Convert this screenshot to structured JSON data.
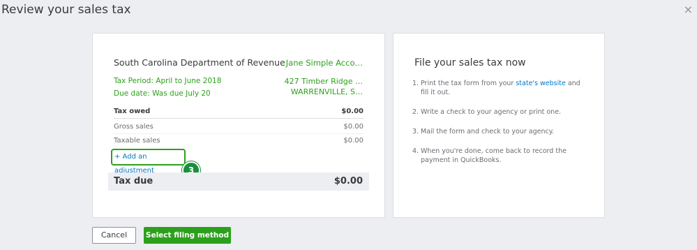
{
  "header": {
    "title": "Review your sales tax",
    "close_glyph": "×"
  },
  "filing": {
    "agency": "South Carolina Department of Revenue",
    "company_name": "Jane Simple Acco…",
    "tax_period": "Tax Period: April to June 2018",
    "due_date": "Due date:  Was due July 20",
    "address_line1": "427 Timber Ridge …",
    "address_line2": "WARRENVILLE, S…",
    "rows": [
      {
        "label": "Tax owed",
        "value": "$0.00"
      },
      {
        "label": "Gross sales",
        "value": "$0.00"
      },
      {
        "label": "Taxable sales",
        "value": "$0.00"
      }
    ],
    "add_adjustment": "+ Add an adjustment",
    "step_badge": "3",
    "tax_due_label": "Tax due",
    "tax_due_value": "$0.00"
  },
  "instructions": {
    "title": "File your sales tax now",
    "steps": [
      {
        "num": "1.",
        "pre": "Print the tax form from your ",
        "link": "state's website",
        "post": " and fill it out."
      },
      {
        "num": "2.",
        "text": "Write a check to your agency or print one."
      },
      {
        "num": "3.",
        "text": "Mail the form and check to your agency."
      },
      {
        "num": "4.",
        "text": "When you're done, come back to record the payment in QuickBooks."
      }
    ]
  },
  "footer": {
    "cancel_label": "Cancel",
    "primary_label": "Select filing method"
  },
  "colors": {
    "brand_green": "#2ca01c",
    "link_blue": "#0077c5",
    "badge_green": "#1a8f3c"
  }
}
